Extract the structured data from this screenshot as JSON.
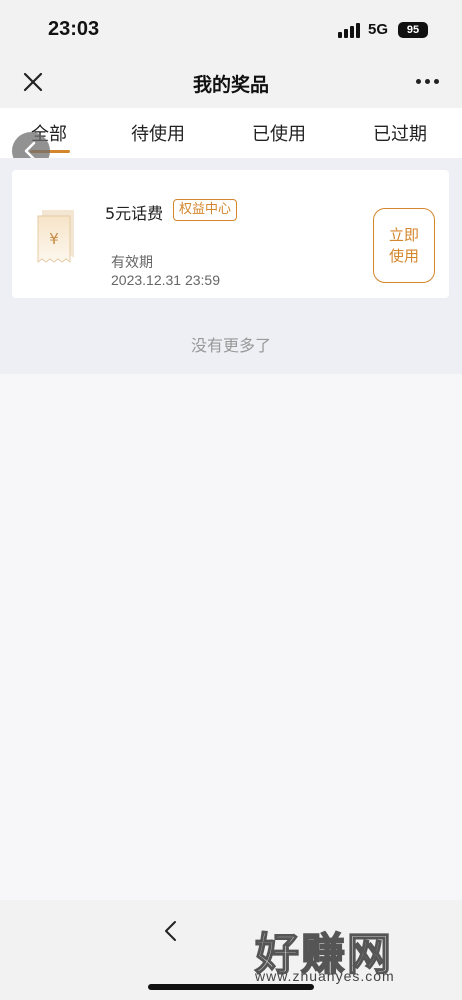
{
  "status_bar": {
    "time": "23:03",
    "network": "5G",
    "battery": "95",
    "icons": [
      "signal-icon",
      "battery-icon"
    ]
  },
  "nav": {
    "title": "我的奖品",
    "icons": [
      "close-icon",
      "more-icon"
    ]
  },
  "tabs": [
    {
      "label": "全部",
      "active": true
    },
    {
      "label": "待使用",
      "active": false
    },
    {
      "label": "已使用",
      "active": false
    },
    {
      "label": "已过期",
      "active": false
    }
  ],
  "prize_list": [
    {
      "name": "5元话费",
      "badge": "权益中心",
      "validity_label": "有效期",
      "validity_date": "2023.12.31 23:59",
      "button_line1": "立即",
      "button_line2": "使用",
      "icon": "coupon-yen-icon"
    }
  ],
  "footer_text": "没有更多了",
  "bottom_bar": {
    "icons": [
      "back-arrow-icon"
    ]
  },
  "watermark": {
    "main": "好赚网",
    "sub": "www.zhuanyes.com"
  },
  "colors": {
    "accent": "#d4862c",
    "background": "#eeeff5",
    "text_muted": "#999999"
  }
}
